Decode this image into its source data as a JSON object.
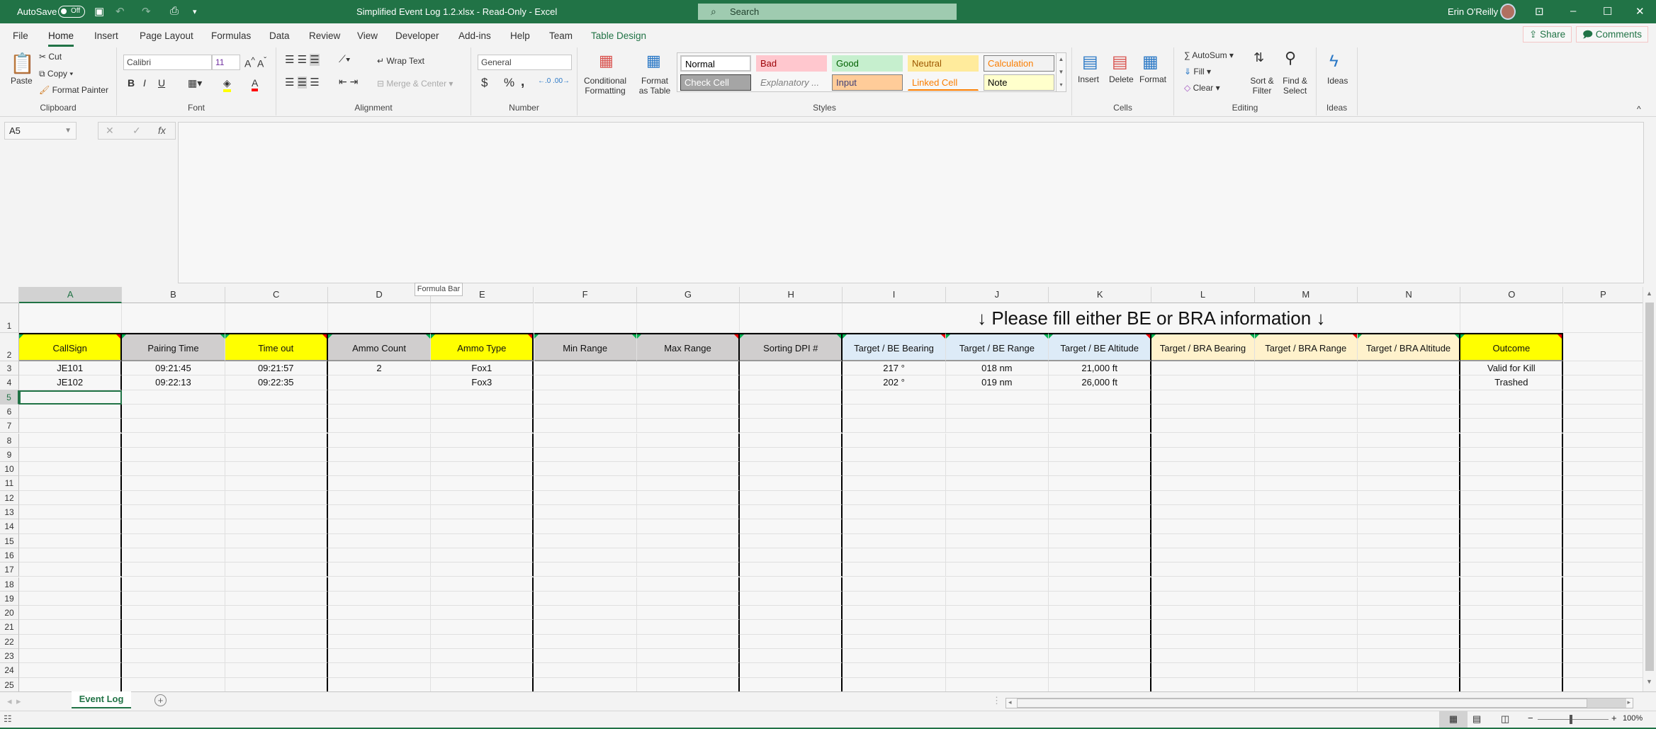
{
  "titlebar": {
    "autosave_label": "AutoSave",
    "autosave_state": "Off",
    "title": "Simplified Event Log 1.2.xlsx  -  Read-Only  -  Excel",
    "search_placeholder": "Search",
    "user_name": "Erin O'Reilly"
  },
  "tabs": [
    "File",
    "Home",
    "Insert",
    "Page Layout",
    "Formulas",
    "Data",
    "Review",
    "View",
    "Developer",
    "Add-ins",
    "Help",
    "Team",
    "Table Design"
  ],
  "share_label": "Share",
  "comments_label": "Comments",
  "ribbon": {
    "clipboard": {
      "paste": "Paste",
      "cut": "Cut",
      "copy": "Copy",
      "format_painter": "Format Painter",
      "label": "Clipboard"
    },
    "font": {
      "name": "Calibri",
      "size": "11",
      "label": "Font",
      "bold": "B",
      "italic": "I",
      "underline": "U"
    },
    "alignment": {
      "wrap_text": "Wrap Text",
      "merge_center": "Merge & Center",
      "label": "Alignment"
    },
    "number": {
      "format": "General",
      "label": "Number",
      "currency": "$",
      "percent": "%",
      "comma": ","
    },
    "styles": {
      "conditional_formatting": "Conditional Formatting",
      "format_as_table": "Format as Table",
      "label": "Styles",
      "gallery": [
        {
          "name": "Normal",
          "bg": "#ffffff",
          "fg": "#000000",
          "border": "#c6c6c6"
        },
        {
          "name": "Bad",
          "bg": "#ffc7ce",
          "fg": "#9c0006",
          "border": "#ffc7ce"
        },
        {
          "name": "Good",
          "bg": "#c6efce",
          "fg": "#006100",
          "border": "#c6efce"
        },
        {
          "name": "Neutral",
          "bg": "#ffeb9c",
          "fg": "#9c5700",
          "border": "#ffeb9c"
        },
        {
          "name": "Calculation",
          "bg": "#f2f2f2",
          "fg": "#fa7d00",
          "border": "#7f7f7f"
        },
        {
          "name": "Check Cell",
          "bg": "#a5a5a5",
          "fg": "#ffffff",
          "border": "#3f3f3f"
        },
        {
          "name": "Explanatory ...",
          "bg": "#f7f7f7",
          "fg": "#7f7f7f",
          "border": "#f7f7f7"
        },
        {
          "name": "Input",
          "bg": "#ffcc99",
          "fg": "#3f3f76",
          "border": "#7f7f7f"
        },
        {
          "name": "Linked Cell",
          "bg": "#f7f7f7",
          "fg": "#fa7d00",
          "border": "#f7f7f7"
        },
        {
          "name": "Note",
          "bg": "#ffffcc",
          "fg": "#000000",
          "border": "#b2b2b2"
        }
      ]
    },
    "cells": {
      "insert": "Insert",
      "delete": "Delete",
      "format": "Format",
      "label": "Cells"
    },
    "editing": {
      "autosum": "AutoSum",
      "fill": "Fill",
      "clear": "Clear",
      "sort_filter": "Sort & Filter",
      "find_select": "Find & Select",
      "label": "Editing"
    },
    "ideas": {
      "ideas": "Ideas",
      "label": "Ideas"
    }
  },
  "formula_bar": {
    "name_box": "A5",
    "formula": "",
    "tooltip": "Formula Bar"
  },
  "sheet": {
    "columns": [
      "A",
      "B",
      "C",
      "D",
      "E",
      "F",
      "G",
      "H",
      "I",
      "J",
      "K",
      "L",
      "M",
      "N",
      "O",
      "P"
    ],
    "selected_cell": "A5",
    "banner": "↓ Please fill either BE or BRA information ↓",
    "headers": [
      "CallSign",
      "Pairing Time",
      "Time out",
      "Ammo Count",
      "Ammo Type",
      "Min Range",
      "Max Range",
      "Sorting DPI #",
      "Target / BE Bearing",
      "Target / BE Range",
      "Target / BE Altitude",
      "Target / BRA Bearing",
      "Target / BRA Range",
      "Target / BRA Altitude",
      "Outcome"
    ],
    "header_colors": [
      "#ffff00",
      "#d0cece",
      "#ffff00",
      "#d0cece",
      "#ffff00",
      "#d0cece",
      "#d0cece",
      "#d0cece",
      "#ddebf7",
      "#ddebf7",
      "#ddebf7",
      "#fff2cc",
      "#fff2cc",
      "#fff2cc",
      "#ffff00"
    ],
    "rows": [
      [
        "JE101",
        "09:21:45",
        "09:21:57",
        "2",
        "Fox1",
        "",
        "",
        "",
        "217 °",
        "018 nm",
        "21,000 ft",
        "",
        "",
        "",
        "Valid for Kill"
      ],
      [
        "JE102",
        "09:22:13",
        "09:22:35",
        "",
        "Fox3",
        "",
        "",
        "",
        "202 °",
        "019 nm",
        "26,000 ft",
        "",
        "",
        "",
        "Trashed"
      ]
    ],
    "row_count": 26
  },
  "sheet_tabs": [
    "Event Log"
  ],
  "status": {
    "zoom": "100%"
  }
}
